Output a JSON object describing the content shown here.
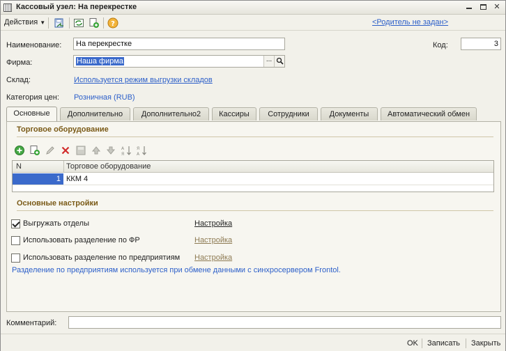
{
  "window": {
    "title": "Кассовый узел: На перекрестке"
  },
  "toolbar": {
    "actions_label": "Действия",
    "parent_link": "<Родитель не задан>"
  },
  "form": {
    "name_label": "Наименование:",
    "name_value": "На перекрестке",
    "code_label": "Код:",
    "code_value": "3",
    "firm_label": "Фирма:",
    "firm_value": "Наша фирма",
    "firm_pick": "...",
    "warehouse_label": "Склад:",
    "warehouse_value": "Используется режим выгрузки складов",
    "price_label": "Категория цен:",
    "price_value": "Розничная (RUB)"
  },
  "tabs": [
    {
      "label": "Основные",
      "active": true
    },
    {
      "label": "Дополнительно",
      "active": false
    },
    {
      "label": "Дополнительно2",
      "active": false
    },
    {
      "label": "Кассиры",
      "active": false
    },
    {
      "label": "Сотрудники",
      "active": false
    },
    {
      "label": "Документы",
      "active": false
    },
    {
      "label": "Автоматический обмен",
      "active": false
    }
  ],
  "equipment": {
    "section_title": "Торговое оборудование",
    "columns": [
      "N",
      "Торговое оборудование"
    ],
    "rows": [
      {
        "n": "1",
        "name": "ККМ 4"
      }
    ]
  },
  "settings": {
    "section_title": "Основные настройки",
    "options": [
      {
        "label": "Выгружать отделы",
        "checked": true,
        "link": "Настройка"
      },
      {
        "label": "Использовать разделение по ФР",
        "checked": false,
        "link": "Настройка"
      },
      {
        "label": "Использовать разделение по предприятиям",
        "checked": false,
        "link": "Настройка"
      }
    ],
    "info_text": "Разделение по предприятиям используется при обмене данными с синхросервером Frontol."
  },
  "comment": {
    "label": "Комментарий:",
    "value": ""
  },
  "buttons": {
    "ok": "OK",
    "save": "Записать",
    "close": "Закрыть"
  },
  "colors": {
    "accent": "#2c5fc9",
    "section": "#7a5a17",
    "selection": "#3b6acb"
  }
}
